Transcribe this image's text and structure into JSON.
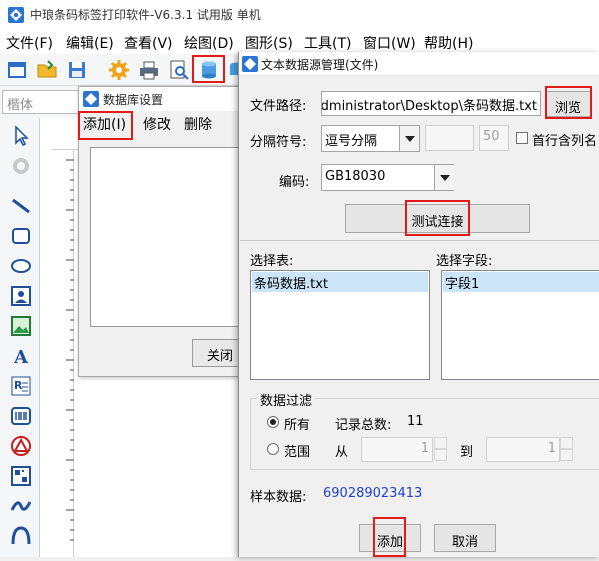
{
  "app": {
    "title": "中琅条码标签打印软件-V6.3.1 试用版 单机"
  },
  "menu": {
    "items": [
      "文件(F)",
      "编辑(E)",
      "查看(V)",
      "绘图(D)",
      "图形(S)",
      "工具(T)",
      "窗口(W)",
      "帮助(H)"
    ]
  },
  "toolbar": {
    "font_placeholder": "楷体"
  },
  "db_dialog": {
    "title": "数据库设置",
    "menu_add": "添加(I)",
    "menu_edit": "修改",
    "menu_delete": "删除",
    "close_label": "关闭"
  },
  "tds_dialog": {
    "title": "文本数据源管理(文件)",
    "file_path_label": "文件路径:",
    "file_path_value": "Administrator\\Desktop\\条码数据.txt",
    "browse_label": "浏览",
    "separator_label": "分隔符号:",
    "separator_value": "逗号分隔",
    "separator_width": "50",
    "first_row_header_label": "首行含列名",
    "encoding_label": "编码:",
    "encoding_value": "GB18030",
    "test_connection_label": "测试连接",
    "select_table_label": "选择表:",
    "tables": [
      "条码数据.txt"
    ],
    "select_field_label": "选择字段:",
    "fields": [
      "字段1"
    ],
    "filter_label": "数据过滤",
    "all_label": "所有",
    "record_total_label": "记录总数:",
    "record_total_value": "11",
    "range_label": "范围",
    "from_label": "从",
    "from_value": "1",
    "to_label": "到",
    "to_value": "1",
    "sample_label": "样本数据:",
    "sample_value": "690289023413",
    "add_label": "添加",
    "cancel_label": "取消"
  },
  "colors": {
    "highlight_red": "#e21a1a",
    "sample_blue": "#1d3fcf",
    "selection_blue": "#cce4f7"
  }
}
